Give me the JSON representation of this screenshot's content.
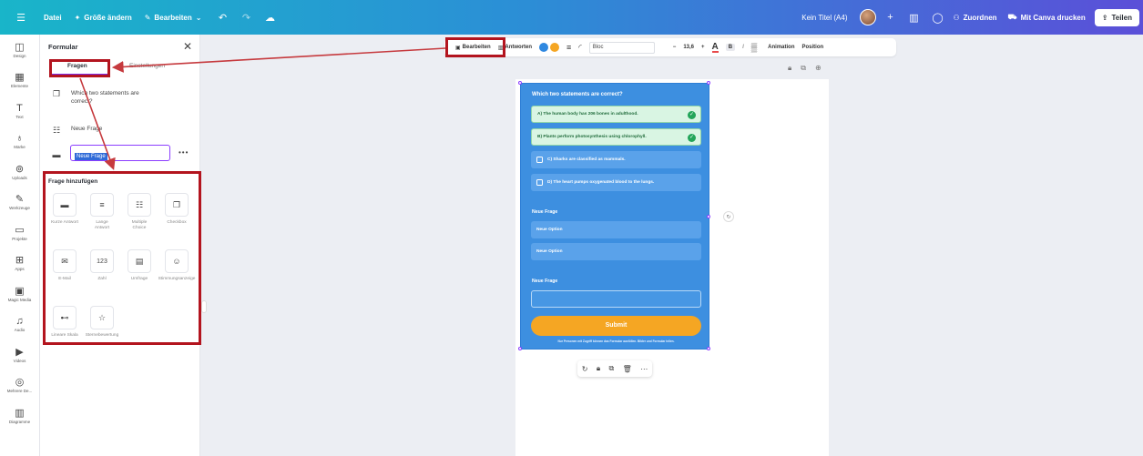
{
  "topbar": {
    "menu_icon": "hamburger-icon",
    "file": "Datei",
    "resize": "Größe ändern",
    "edit": "Bearbeiten",
    "title": "Kein Titel (A4)",
    "assign": "Zuordnen",
    "print": "Mit Canva drucken",
    "share": "Teilen"
  },
  "rail": [
    {
      "label": "Design",
      "icon": "layout-icon"
    },
    {
      "label": "Elemente",
      "icon": "elements-icon"
    },
    {
      "label": "Text",
      "icon": "text-icon"
    },
    {
      "label": "Marke",
      "icon": "brand-icon"
    },
    {
      "label": "Uploads",
      "icon": "upload-icon"
    },
    {
      "label": "Werkzeuge",
      "icon": "tools-icon"
    },
    {
      "label": "Projekte",
      "icon": "folder-icon"
    },
    {
      "label": "Apps",
      "icon": "apps-icon"
    },
    {
      "label": "Magic Media",
      "icon": "magic-icon"
    },
    {
      "label": "Audio",
      "icon": "audio-icon"
    },
    {
      "label": "Videos",
      "icon": "video-icon"
    },
    {
      "label": "Mehrere De...",
      "icon": "multi-icon"
    },
    {
      "label": "Diagramme",
      "icon": "chart-icon"
    }
  ],
  "panel": {
    "title": "Formular",
    "tab_questions": "Fragen",
    "tab_settings": "Einstellungen",
    "question_1": "Which two statements are correct?",
    "question_2": "Neue Frage",
    "question_input": "Neue Frage",
    "add_title": "Frage hinzufügen",
    "types": [
      {
        "label": "Kurze Antwort",
        "glyph": "▬"
      },
      {
        "label": "Lange Antwort",
        "glyph": "≡"
      },
      {
        "label": "Multiple Choice",
        "glyph": "☷"
      },
      {
        "label": "Checkbox",
        "glyph": "❐"
      },
      {
        "label": "E-Mail",
        "glyph": "✉"
      },
      {
        "label": "Zahl",
        "glyph": "123"
      },
      {
        "label": "Umfrage",
        "glyph": "▤"
      },
      {
        "label": "Stimmungsanzeige",
        "glyph": "☺"
      },
      {
        "label": "Lineare Skala",
        "glyph": "⊷"
      },
      {
        "label": "Sternebewertung",
        "glyph": "☆"
      }
    ]
  },
  "toolbar": {
    "edit": "Bearbeiten",
    "answers": "Antworten",
    "font": "Bloc",
    "font_size": "13,6",
    "bold": "B",
    "italic": "I",
    "animation": "Animation",
    "position": "Position",
    "color_blue": "#2f88e0",
    "color_orange": "#f5a623"
  },
  "form": {
    "title": "Which two statements are correct?",
    "option_a": "A) The human body has 206 bones in adulthood.",
    "option_b": "B) Plants perform photosynthesis using chlorophyll.",
    "option_c": "C) Sharks are classified as mammals.",
    "option_d": "D) The heart pumps oxygenated blood to the lungs.",
    "section_2": "Neue Frage",
    "option_new_1": "Neue Option",
    "option_new_2": "Neue Option",
    "section_3": "Neue Frage",
    "submit": "Submit",
    "footnote": "Nur Personen mit Zugriff können das Formular ausfüllen. Bilder und Formular teilen."
  }
}
